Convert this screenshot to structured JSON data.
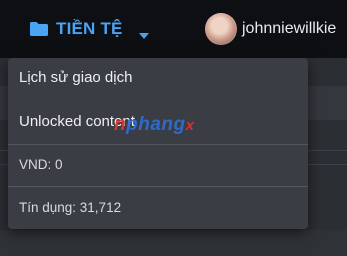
{
  "header": {
    "currency_label": "TIỀN TỆ",
    "username": "johnniewillkie"
  },
  "dropdown": {
    "items": [
      {
        "label": "Lịch sử giao dịch"
      },
      {
        "label": "Unlocked content"
      }
    ],
    "vnd_balance": "VND: 0",
    "credit_balance": "Tín dụng: 31,712"
  },
  "watermark": {
    "part1": "n",
    "part2": "phang",
    "part3": "x"
  },
  "colors": {
    "accent": "#4aa3f5",
    "topbar": "#0d0f12",
    "menu_bg": "#3a3d44"
  },
  "icons": {
    "currency": "folder-icon",
    "toggle": "caret-down-icon"
  }
}
